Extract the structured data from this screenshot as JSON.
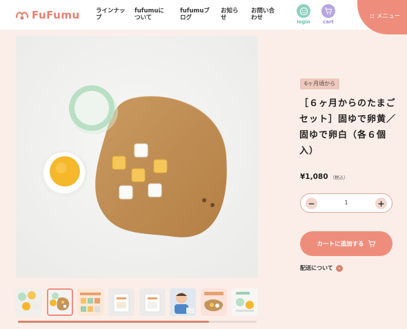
{
  "header": {
    "logo_text": "FuFumu",
    "nav": [
      {
        "label": "ラインナップ"
      },
      {
        "label": "fufumuについて"
      },
      {
        "label": "fufumuブログ"
      },
      {
        "label": "お知らせ"
      },
      {
        "label": "お問い合わせ"
      }
    ],
    "login_label": "login",
    "cart_label": "cart",
    "menu_label": "メニュー"
  },
  "product": {
    "age_badge": "6ヶ月頃から",
    "title": "［６ヶ月からのたまごセット］固ゆで卵黄／固ゆで卵白（各６個入）",
    "price": "¥1,080",
    "tax_note": "（税込）",
    "quantity": "1",
    "decrement_symbol": "−",
    "increment_symbol": "+",
    "add_to_cart_label": "カートに追加する",
    "shipping_label": "配送について"
  },
  "gallery": {
    "thumbnail_count": 8,
    "active_index": 1,
    "scroll_progress": 0.8
  },
  "colors": {
    "accent": "#ef8d7c",
    "background": "#fbeee8",
    "login_circle": "#8fd0c0",
    "cart_circle": "#b7a6e0"
  }
}
